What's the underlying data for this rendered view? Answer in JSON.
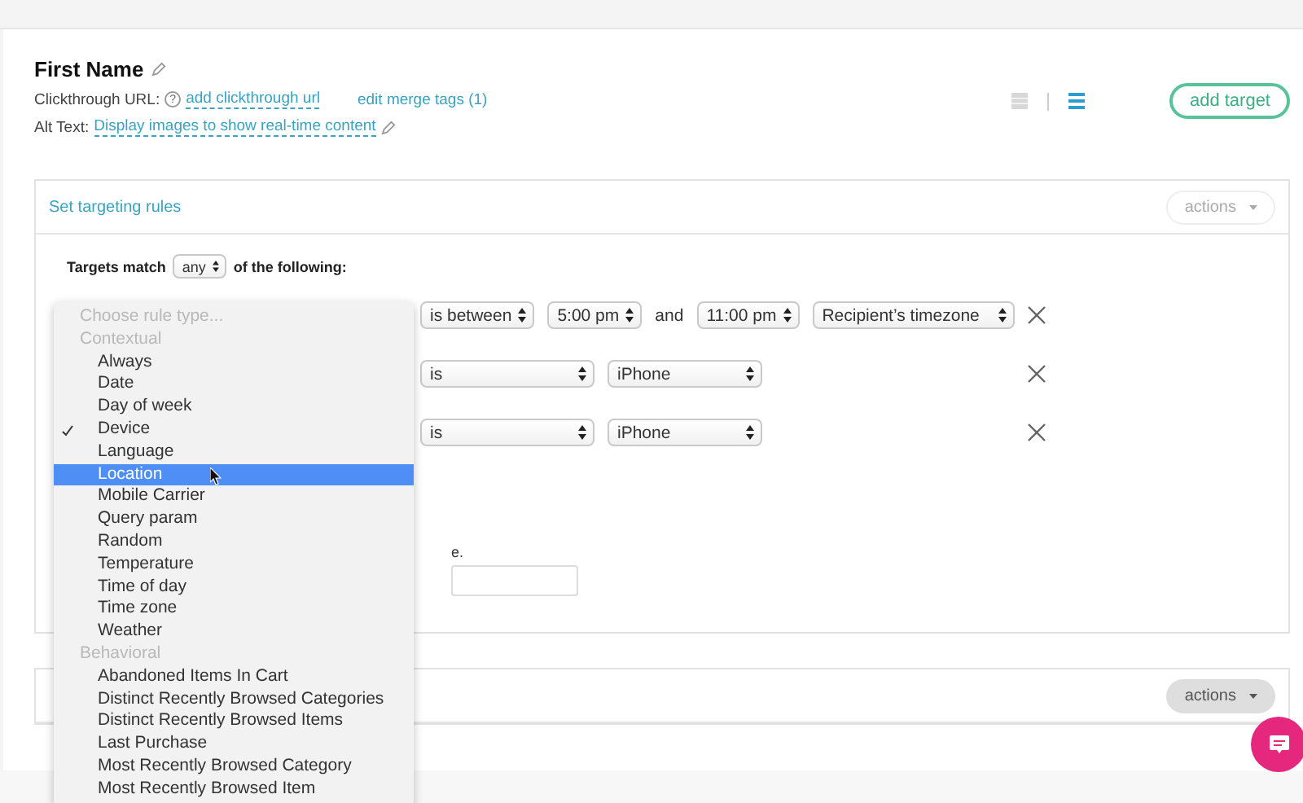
{
  "header": {
    "title": "First Name",
    "clickthrough_label": "Clickthrough URL:",
    "help_mark": "?",
    "clickthrough_link": "add clickthrough url",
    "merge_tags_link": "edit merge tags (1)",
    "alt_label": "Alt Text:",
    "alt_link": "Display images to show real-time content"
  },
  "view_toggle": [
    {
      "kind": "grid",
      "selected": false
    },
    {
      "kind": "list",
      "selected": true
    }
  ],
  "add_target": "add target",
  "targeting_panel": {
    "title": "Set targeting rules",
    "actions": {
      "label": "actions",
      "disabled": true
    },
    "match_prefix": "Targets match",
    "match_value": "any",
    "match_suffix": "of the following:",
    "rules": [
      {
        "controls": [
          {
            "kind": "select",
            "value": "is between"
          },
          {
            "kind": "select",
            "value": "5:00 pm"
          },
          {
            "kind": "text",
            "value": "and"
          },
          {
            "kind": "select",
            "value": "11:00 pm"
          },
          {
            "kind": "select",
            "value": "Recipient’s timezone"
          }
        ]
      },
      {
        "controls": [
          {
            "kind": "select",
            "value": "is"
          },
          {
            "kind": "select",
            "value": "iPhone"
          }
        ]
      },
      {
        "controls": [
          {
            "kind": "select",
            "value": "is"
          },
          {
            "kind": "select",
            "value": "iPhone"
          }
        ]
      }
    ],
    "hint_fragment": "e.",
    "dropdown": [
      {
        "kind": "placeholder",
        "label": "Choose rule type..."
      },
      {
        "kind": "group",
        "label": "Contextual"
      },
      {
        "kind": "option",
        "label": "Always",
        "checked": false,
        "highlighted": false
      },
      {
        "kind": "option",
        "label": "Date",
        "checked": false,
        "highlighted": false
      },
      {
        "kind": "option",
        "label": "Day of week",
        "checked": false,
        "highlighted": false
      },
      {
        "kind": "option",
        "label": "Device",
        "checked": true,
        "highlighted": false
      },
      {
        "kind": "option",
        "label": "Language",
        "checked": false,
        "highlighted": false
      },
      {
        "kind": "option",
        "label": "Location",
        "checked": false,
        "highlighted": true
      },
      {
        "kind": "option",
        "label": "Mobile Carrier",
        "checked": false,
        "highlighted": false
      },
      {
        "kind": "option",
        "label": "Query param",
        "checked": false,
        "highlighted": false
      },
      {
        "kind": "option",
        "label": "Random",
        "checked": false,
        "highlighted": false
      },
      {
        "kind": "option",
        "label": "Temperature",
        "checked": false,
        "highlighted": false
      },
      {
        "kind": "option",
        "label": "Time of day",
        "checked": false,
        "highlighted": false
      },
      {
        "kind": "option",
        "label": "Time zone",
        "checked": false,
        "highlighted": false
      },
      {
        "kind": "option",
        "label": "Weather",
        "checked": false,
        "highlighted": false
      },
      {
        "kind": "group",
        "label": "Behavioral"
      },
      {
        "kind": "option",
        "label": "Abandoned Items In Cart",
        "checked": false,
        "highlighted": false
      },
      {
        "kind": "option",
        "label": "Distinct Recently Browsed Categories",
        "checked": false,
        "highlighted": false
      },
      {
        "kind": "option",
        "label": "Distinct Recently Browsed Items",
        "checked": false,
        "highlighted": false
      },
      {
        "kind": "option",
        "label": "Last Purchase",
        "checked": false,
        "highlighted": false
      },
      {
        "kind": "option",
        "label": "Most Recently Browsed Category",
        "checked": false,
        "highlighted": false
      },
      {
        "kind": "option",
        "label": "Most Recently Browsed Item",
        "checked": false,
        "highlighted": false
      }
    ]
  },
  "second_panel": {
    "actions": {
      "label": "actions",
      "disabled": false
    }
  }
}
